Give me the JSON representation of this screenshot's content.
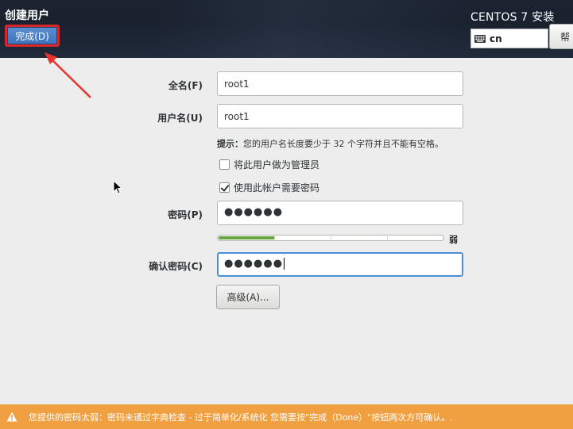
{
  "header": {
    "page_title": "创建用户",
    "done_button": "完成(D)",
    "product_title": "CENTOS 7 安装",
    "keyboard_layout": "cn",
    "help_button": "帮"
  },
  "form": {
    "fullname": {
      "label": "全名(F)",
      "value": "root1"
    },
    "username": {
      "label": "用户名(U)",
      "value": "root1"
    },
    "hint_bold": "提示：",
    "hint_text": "您的用户名长度要少于 32 个字符并且不能有空格。",
    "admin_checkbox": {
      "label": "将此用户做为管理员",
      "checked": false
    },
    "require_password_checkbox": {
      "label": "使用此帐户需要密码",
      "checked": true
    },
    "password": {
      "label": "密码(P)",
      "value": "●●●●●●"
    },
    "strength": {
      "text": "弱",
      "level": 0.25
    },
    "confirm": {
      "label": "确认密码(C)",
      "value": "●●●●●●"
    },
    "advanced_button": "高级(A)..."
  },
  "warning": {
    "text": "您提供的密码太弱：密码未通过字典检查 - 过于简单化/系统化 您需要按\"完成（Done）\"按钮两次方可确认。."
  },
  "colors": {
    "accent_blue": "#3d73be",
    "annotation_red": "#d8262b",
    "strength_green": "#67a53f",
    "warning_orange": "#f0a041"
  }
}
